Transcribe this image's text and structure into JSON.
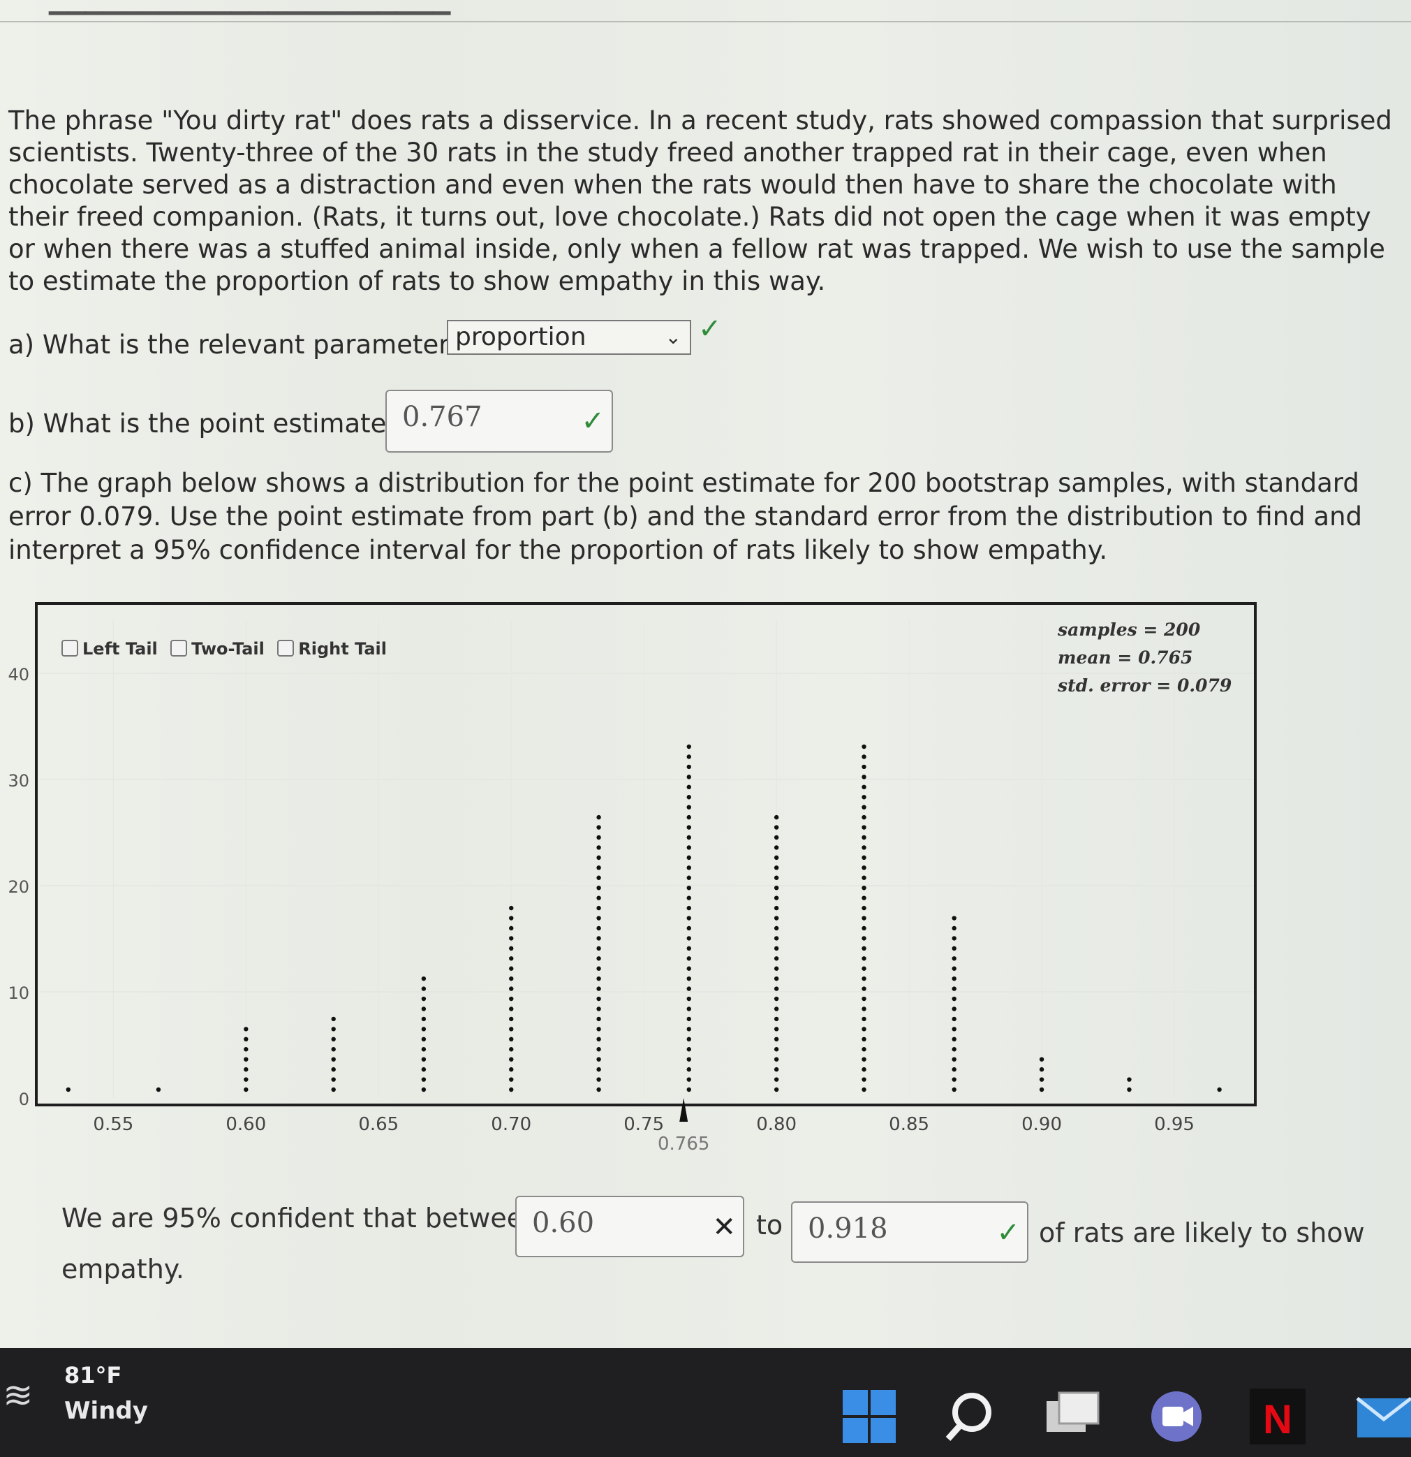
{
  "problem_text": "The phrase \"You dirty rat\" does rats a disservice. In a recent study, rats showed compassion that surprised scientists. Twenty-three of the 30 rats in the study freed another trapped rat in their cage, even when chocolate served as a distraction and even when the rats would then have to share the chocolate with their freed companion. (Rats, it turns out, love chocolate.) Rats did not open the cage when it was empty or when there was a stuffed animal inside, only when a fellow rat was trapped. We wish to use the sample to estimate the proportion of rats to show empathy in this way.",
  "part_a": {
    "question": "a) What is the relevant parameter?",
    "selected": "proportion",
    "status": "correct"
  },
  "part_b": {
    "question": "b) What is the point estimate?",
    "value": "0.767",
    "status": "correct"
  },
  "part_c": {
    "question": "c) The graph below shows a distribution for the point estimate for 200 bootstrap samples, with standard error 0.079.  Use the point estimate from part (b) and the standard error from the distribution to find and interpret a 95% confidence interval for the proportion of rats likely to show empathy."
  },
  "tail_options": [
    "Left Tail",
    "Two-Tail",
    "Right Tail"
  ],
  "stats": {
    "samples": "samples = 200",
    "mean": "mean = 0.765",
    "std_error": "std. error = 0.079"
  },
  "chart_data": {
    "type": "scatter",
    "subtype": "dotplot",
    "x": [
      0.533,
      0.567,
      0.6,
      0.633,
      0.667,
      0.7,
      0.733,
      0.767,
      0.8,
      0.833,
      0.867,
      0.9,
      0.933,
      0.967
    ],
    "counts": [
      1,
      1,
      7,
      8,
      12,
      19,
      28,
      35,
      28,
      35,
      18,
      4,
      2,
      1
    ],
    "x_ticks": [
      "0.55",
      "0.60",
      "0.65",
      "0.70",
      "0.75",
      "0.80",
      "0.85",
      "0.90",
      "0.95"
    ],
    "y_ticks": [
      "0",
      "10",
      "20",
      "30",
      "40"
    ],
    "xlim": [
      0.522,
      0.98
    ],
    "ylim": [
      0,
      45
    ],
    "mean_marker": "0.765"
  },
  "answer": {
    "prefix": "We are 95% confident that between",
    "lower": "0.60",
    "lower_status": "incorrect",
    "to": "to",
    "upper": "0.918",
    "upper_status": "correct",
    "suffix": "of rats are likely to show",
    "suffix2": "empathy."
  },
  "taskbar": {
    "temperature": "81°F",
    "condition": "Windy"
  },
  "colors": {
    "correct": "#2e8b3a",
    "incorrect": "#222222",
    "netflix": "#e50914",
    "windows": "#3a8ee6"
  }
}
